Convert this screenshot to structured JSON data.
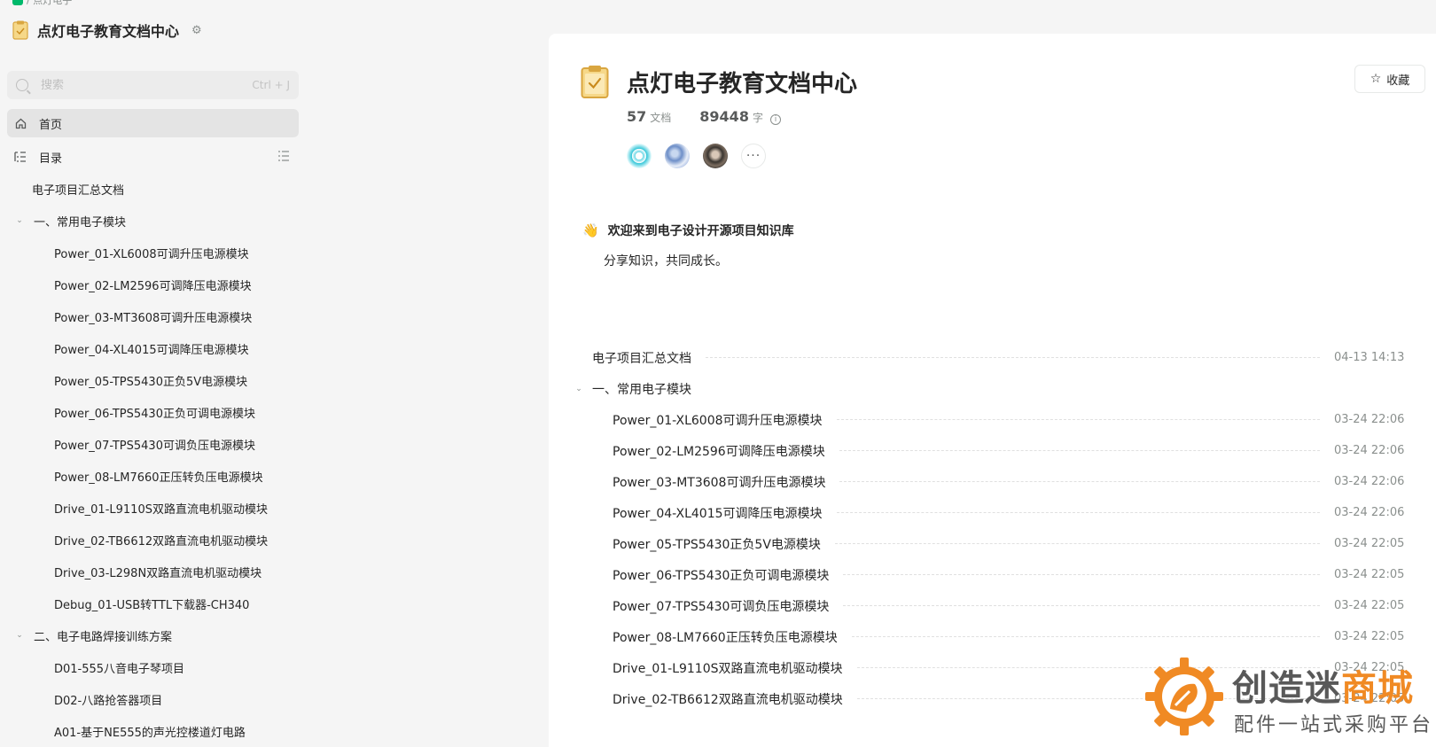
{
  "sidebar": {
    "breadcrumb": "/ 点灯电子",
    "kb_title": "点灯电子教育文档中心",
    "search": {
      "placeholder": "搜索",
      "shortcut": "Ctrl + J"
    },
    "nav": {
      "home": "首页",
      "toc": "目录"
    },
    "tree": [
      {
        "label": "电子项目汇总文档",
        "level": 0
      },
      {
        "label": "一、常用电子模块",
        "level": "group"
      },
      {
        "label": "Power_01-XL6008可调升压电源模块",
        "level": 1
      },
      {
        "label": "Power_02-LM2596可调降压电源模块",
        "level": 1
      },
      {
        "label": "Power_03-MT3608可调升压电源模块",
        "level": 1
      },
      {
        "label": "Power_04-XL4015可调降压电源模块",
        "level": 1
      },
      {
        "label": "Power_05-TPS5430正负5V电源模块",
        "level": 1
      },
      {
        "label": "Power_06-TPS5430正负可调电源模块",
        "level": 1
      },
      {
        "label": "Power_07-TPS5430可调负压电源模块",
        "level": 1
      },
      {
        "label": "Power_08-LM7660正压转负压电源模块",
        "level": 1
      },
      {
        "label": "Drive_01-L9110S双路直流电机驱动模块",
        "level": 1
      },
      {
        "label": "Drive_02-TB6612双路直流电机驱动模块",
        "level": 1
      },
      {
        "label": "Drive_03-L298N双路直流电机驱动模块",
        "level": 1
      },
      {
        "label": "Debug_01-USB转TTL下载器-CH340",
        "level": 1
      },
      {
        "label": "二、电子电路焊接训练方案",
        "level": "group"
      },
      {
        "label": "D01-555八音电子琴项目",
        "level": 1
      },
      {
        "label": "D02-八路抢答器项目",
        "level": 1
      },
      {
        "label": "A01-基于NE555的声光控楼道灯电路",
        "level": 1
      }
    ]
  },
  "main": {
    "title": "点灯电子教育文档中心",
    "favorite_label": "收藏",
    "stats": {
      "docs_count": "57",
      "docs_unit": "文档",
      "words_count": "89448",
      "words_unit": "字"
    },
    "more_members": "···",
    "welcome_title": "欢迎来到电子设计开源项目知识库",
    "welcome_sub": "分享知识，共同成长。",
    "toc": [
      {
        "label": "电子项目汇总文档",
        "date": "04-13 14:13",
        "level": 0
      },
      {
        "label": "一、常用电子模块",
        "date": "",
        "level": "group"
      },
      {
        "label": "Power_01-XL6008可调升压电源模块",
        "date": "03-24 22:06",
        "level": 1
      },
      {
        "label": "Power_02-LM2596可调降压电源模块",
        "date": "03-24 22:06",
        "level": 1
      },
      {
        "label": "Power_03-MT3608可调升压电源模块",
        "date": "03-24 22:06",
        "level": 1
      },
      {
        "label": "Power_04-XL4015可调降压电源模块",
        "date": "03-24 22:06",
        "level": 1
      },
      {
        "label": "Power_05-TPS5430正负5V电源模块",
        "date": "03-24 22:05",
        "level": 1
      },
      {
        "label": "Power_06-TPS5430正负可调电源模块",
        "date": "03-24 22:05",
        "level": 1
      },
      {
        "label": "Power_07-TPS5430可调负压电源模块",
        "date": "03-24 22:05",
        "level": 1
      },
      {
        "label": "Power_08-LM7660正压转负压电源模块",
        "date": "03-24 22:05",
        "level": 1
      },
      {
        "label": "Drive_01-L9110S双路直流电机驱动模块",
        "date": "03-24 22:05",
        "level": 1
      },
      {
        "label": "Drive_02-TB6612双路直流电机驱动模块",
        "date": "03-24 22:05",
        "level": 1
      }
    ]
  },
  "watermark": {
    "name_part1": "创造迷",
    "name_part2": "商城",
    "tagline": "配件一站式采购平台"
  },
  "colors": {
    "accent_green": "#00b96b",
    "watermark_orange": "#f08a24",
    "text": "#262626",
    "muted": "#8a8f8d"
  }
}
